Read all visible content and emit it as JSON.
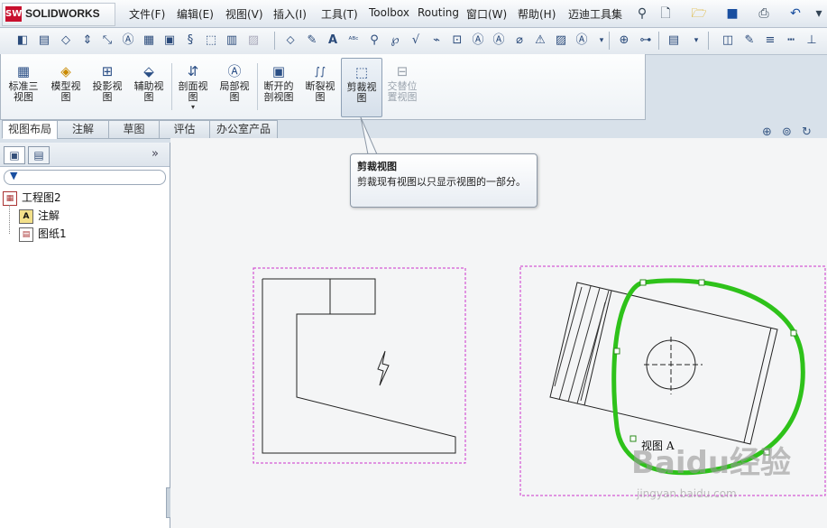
{
  "app": {
    "brand": "SOLIDWORKS",
    "logo_badge": "SW"
  },
  "menu": [
    "文件(F)",
    "编辑(E)",
    "视图(V)",
    "插入(I)",
    "工具(T)",
    "Toolbox",
    "Routing",
    "窗口(W)",
    "帮助(H)",
    "迈迪工具集"
  ],
  "quick_icons": [
    "pin-icon",
    "new-document-icon",
    "open-folder-icon",
    "save-icon",
    "print-icon",
    "undo-icon",
    "redo-icon"
  ],
  "commands": [
    {
      "label": "标准三\n视图",
      "icon": "▦",
      "name": "standard-3-view"
    },
    {
      "label": "模型视\n图",
      "icon": "◈",
      "name": "model-view"
    },
    {
      "label": "投影视\n图",
      "icon": "⊞",
      "name": "projected-view"
    },
    {
      "label": "辅助视\n图",
      "icon": "⬙",
      "name": "auxiliary-view"
    },
    {
      "label": "剖面视\n图",
      "icon": "⇵",
      "name": "section-view"
    },
    {
      "label": "局部视\n图",
      "icon": "Ⓐ",
      "name": "detail-view"
    },
    {
      "label": "断开的\n剖视图",
      "icon": "▣",
      "name": "broken-out-section"
    },
    {
      "label": "断裂视\n图",
      "icon": "∫∫",
      "name": "break-view"
    },
    {
      "label": "剪裁视\n图",
      "icon": "⬚",
      "name": "crop-view"
    },
    {
      "label": "交替位\n置视图",
      "icon": "⊟",
      "name": "alternate-position-view"
    }
  ],
  "tabs": [
    "视图布局",
    "注解",
    "草图",
    "评估",
    "办公室产品"
  ],
  "tree": {
    "root": "工程图2",
    "items": [
      "注解",
      "图纸1"
    ]
  },
  "tooltip": {
    "title": "剪裁视图",
    "body": "剪裁现有视图以只显示视图的一部分。"
  },
  "view_label": "视图 A",
  "colors": {
    "crop_green": "#2ec21a",
    "view_border": "#cc33cc"
  },
  "watermark": {
    "main": "Baidu经验",
    "sub": "jingyan.baidu.com"
  }
}
